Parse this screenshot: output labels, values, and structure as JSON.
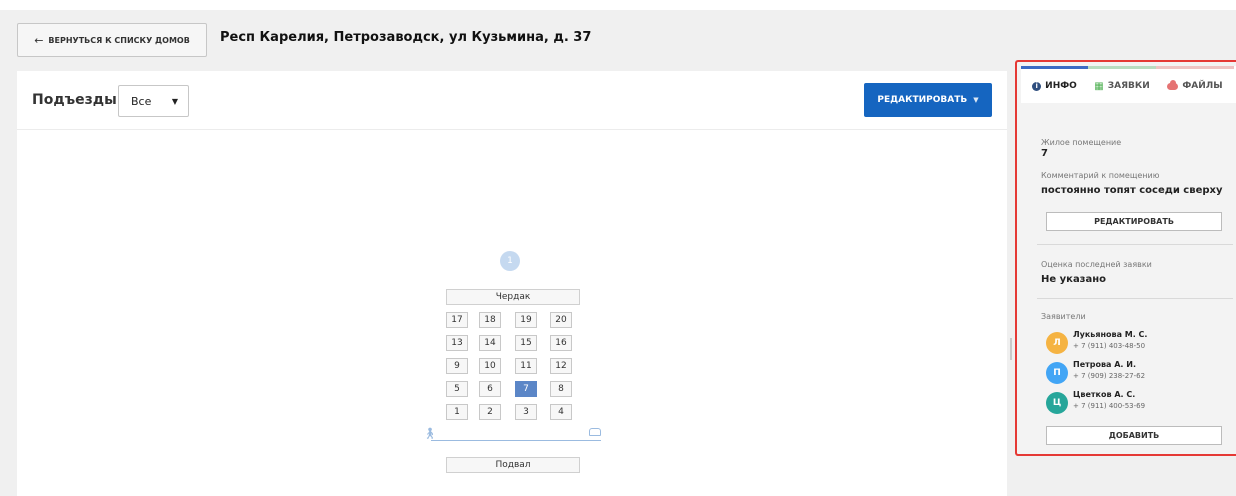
{
  "header": {
    "back_label": "ВЕРНУТЬСЯ К СПИСКУ ДОМОВ",
    "address": "Респ Карелия, Петрозаводск, ул Кузьмина, д. 37"
  },
  "toolbar": {
    "entrances_label": "Подъезды:",
    "entrance_value": "Все",
    "edit_label": "РЕДАКТИРОВАТЬ"
  },
  "scheme": {
    "entrance_number": "1",
    "attic": "Чердак",
    "basement": "Подвал",
    "floors": [
      [
        "17",
        "18",
        "19",
        "20"
      ],
      [
        "13",
        "14",
        "15",
        "16"
      ],
      [
        "9",
        "10",
        "11",
        "12"
      ],
      [
        "5",
        "6",
        "7",
        "8"
      ],
      [
        "1",
        "2",
        "3",
        "4"
      ]
    ],
    "selected_apartment": "7"
  },
  "panel": {
    "tabs": {
      "info": "ИНФО",
      "requests": "ЗАЯВКИ",
      "files": "ФАЙЛЫ"
    },
    "room_type_label": "Жилое помещение",
    "room_number": "7",
    "comment_label": "Комментарий к помещению",
    "comment_text": "постоянно топят соседи сверху",
    "edit_label": "РЕДАКТИРОВАТЬ",
    "rating_label": "Оценка последней заявки",
    "rating_value": "Не указано",
    "applicants_label": "Заявители",
    "applicants": [
      {
        "initial": "Л",
        "name": "Лукьянова М. С.",
        "phone": "+ 7 (911) 403-48-50",
        "color": "#f5b342"
      },
      {
        "initial": "П",
        "name": "Петрова А. И.",
        "phone": "+ 7 (909) 238-27-62",
        "color": "#42a5f5"
      },
      {
        "initial": "Ц",
        "name": "Цветков А. С.",
        "phone": "+ 7 (911) 400-53-69",
        "color": "#26a69a"
      }
    ],
    "add_label": "ДОБАВИТЬ"
  },
  "colors": {
    "accent": "#1565c0",
    "highlight_border": "#e53935",
    "selected_apartment": "#5b86c7"
  }
}
